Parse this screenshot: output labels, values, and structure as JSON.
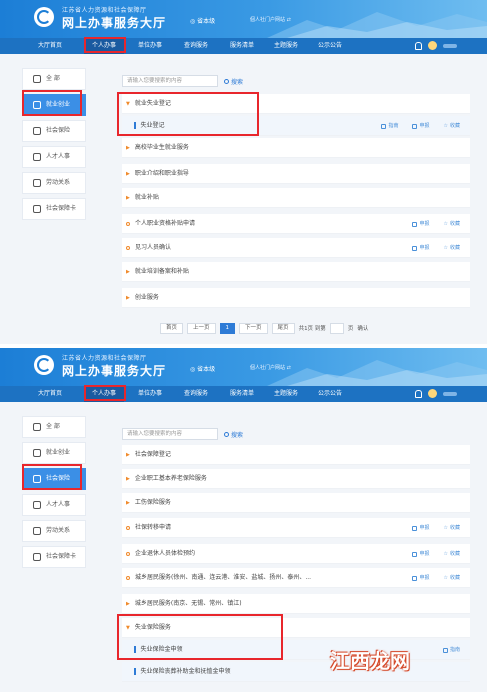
{
  "header": {
    "subtitle": "江苏省人力资源和社会保障厅",
    "title": "网上办事服务大厅",
    "location": "省本级",
    "portal": "個人社门户网站 ⇄"
  },
  "nav": [
    "大厅首页",
    "个人办事",
    "单位办事",
    "查询服务",
    "服务清单",
    "主题服务",
    "公示公告"
  ],
  "sidebar": [
    "全 部",
    "就业创业",
    "社会保险",
    "人才人事",
    "劳动关系",
    "社会保障卡"
  ],
  "search": {
    "placeholder": "请输入您要搜索的内容",
    "button": "搜索"
  },
  "actions": {
    "guide": "指南",
    "handle": "申报",
    "favorite": "收藏"
  },
  "panel1": {
    "rows": [
      "就业失业登记",
      "失业登记",
      "高校毕业生就业服务",
      "职业介绍和职业指导",
      "就业补贴",
      "个人职业资格补贴申请",
      "见习人员确认",
      "就业培训备案和补贴",
      "创业服务"
    ]
  },
  "panel2": {
    "rows": [
      "社会保障登记",
      "企业职工基本养老保险服务",
      "工伤保险服务",
      "社保转移申请",
      "企业退休人员体检预约",
      "城乡居民服务(徐州、南通、连云港、淮安、盐城、扬州、泰州、...",
      "城乡居民服务(南京、无锡、常州、镇江)",
      "失业保险服务",
      "失业保险金申领",
      "失业保险丧葬补助金和抚恤金申领"
    ]
  },
  "pager": {
    "first": "首页",
    "prev": "上一页",
    "current": "1",
    "next": "下一页",
    "last": "尾页",
    "total": "共1页 到第",
    "page": "页",
    "confirm": "确认"
  },
  "watermark": "江西龙网"
}
